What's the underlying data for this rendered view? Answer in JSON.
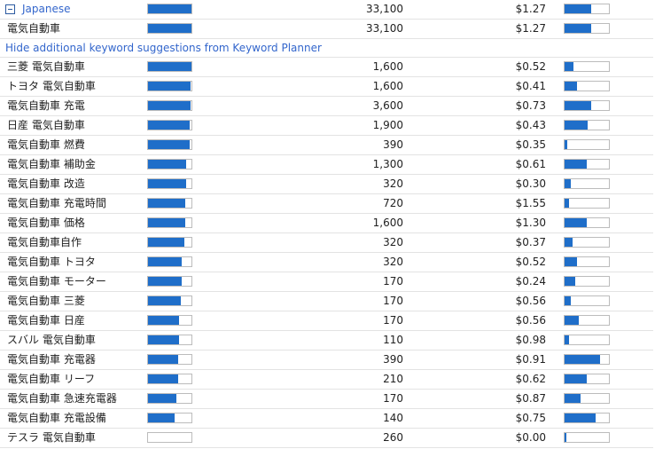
{
  "language_group": {
    "label": "Japanese",
    "competition": 1.0,
    "monthly_searches": "33,100",
    "avg_cpc": "$1.27",
    "cpc_level": 0.6
  },
  "main_keyword": {
    "keyword": "電気自動車",
    "competition": 1.0,
    "monthly_searches": "33,100",
    "avg_cpc": "$1.27",
    "cpc_level": 0.6
  },
  "hide_link": "Hide additional keyword suggestions from Keyword Planner",
  "rows": [
    {
      "keyword": "三菱 電気自動車",
      "competition": 1.0,
      "monthly_searches": "1,600",
      "avg_cpc": "$0.52",
      "cpc_level": 0.2
    },
    {
      "keyword": "トヨタ 電気自動車",
      "competition": 0.98,
      "monthly_searches": "1,600",
      "avg_cpc": "$0.41",
      "cpc_level": 0.28
    },
    {
      "keyword": "電気自動車 充電",
      "competition": 0.98,
      "monthly_searches": "3,600",
      "avg_cpc": "$0.73",
      "cpc_level": 0.6
    },
    {
      "keyword": "日産 電気自動車",
      "competition": 0.96,
      "monthly_searches": "1,900",
      "avg_cpc": "$0.43",
      "cpc_level": 0.52
    },
    {
      "keyword": "電気自動車 燃費",
      "competition": 0.96,
      "monthly_searches": "390",
      "avg_cpc": "$0.35",
      "cpc_level": 0.06
    },
    {
      "keyword": "電気自動車 補助金",
      "competition": 0.88,
      "monthly_searches": "1,300",
      "avg_cpc": "$0.61",
      "cpc_level": 0.5
    },
    {
      "keyword": "電気自動車 改造",
      "competition": 0.88,
      "monthly_searches": "320",
      "avg_cpc": "$0.30",
      "cpc_level": 0.14
    },
    {
      "keyword": "電気自動車 充電時間",
      "competition": 0.86,
      "monthly_searches": "720",
      "avg_cpc": "$1.55",
      "cpc_level": 0.1
    },
    {
      "keyword": "電気自動車 価格",
      "competition": 0.86,
      "monthly_searches": "1,600",
      "avg_cpc": "$1.30",
      "cpc_level": 0.5
    },
    {
      "keyword": "電気自動車自作",
      "competition": 0.84,
      "monthly_searches": "320",
      "avg_cpc": "$0.37",
      "cpc_level": 0.18
    },
    {
      "keyword": "電気自動車 トヨタ",
      "competition": 0.78,
      "monthly_searches": "320",
      "avg_cpc": "$0.52",
      "cpc_level": 0.28
    },
    {
      "keyword": "電気自動車 モーター",
      "competition": 0.78,
      "monthly_searches": "170",
      "avg_cpc": "$0.24",
      "cpc_level": 0.24
    },
    {
      "keyword": "電気自動車 三菱",
      "competition": 0.76,
      "monthly_searches": "170",
      "avg_cpc": "$0.56",
      "cpc_level": 0.14
    },
    {
      "keyword": "電気自動車 日産",
      "competition": 0.72,
      "monthly_searches": "170",
      "avg_cpc": "$0.56",
      "cpc_level": 0.32
    },
    {
      "keyword": "スバル 電気自動車",
      "competition": 0.72,
      "monthly_searches": "110",
      "avg_cpc": "$0.98",
      "cpc_level": 0.1
    },
    {
      "keyword": "電気自動車 充電器",
      "competition": 0.7,
      "monthly_searches": "390",
      "avg_cpc": "$0.91",
      "cpc_level": 0.8
    },
    {
      "keyword": "電気自動車 リーフ",
      "competition": 0.7,
      "monthly_searches": "210",
      "avg_cpc": "$0.62",
      "cpc_level": 0.5
    },
    {
      "keyword": "電気自動車 急速充電器",
      "competition": 0.66,
      "monthly_searches": "170",
      "avg_cpc": "$0.87",
      "cpc_level": 0.36
    },
    {
      "keyword": "電気自動車 充電設備",
      "competition": 0.62,
      "monthly_searches": "140",
      "avg_cpc": "$0.75",
      "cpc_level": 0.7
    },
    {
      "keyword": "テスラ 電気自動車",
      "competition": 0.0,
      "monthly_searches": "260",
      "avg_cpc": "$0.00",
      "cpc_level": 0.03
    }
  ],
  "colors": {
    "bar_fill": "#1f6ec9",
    "bar_border": "#bcbcbc",
    "link": "#3366cc",
    "row_border": "#e3e3e3"
  }
}
